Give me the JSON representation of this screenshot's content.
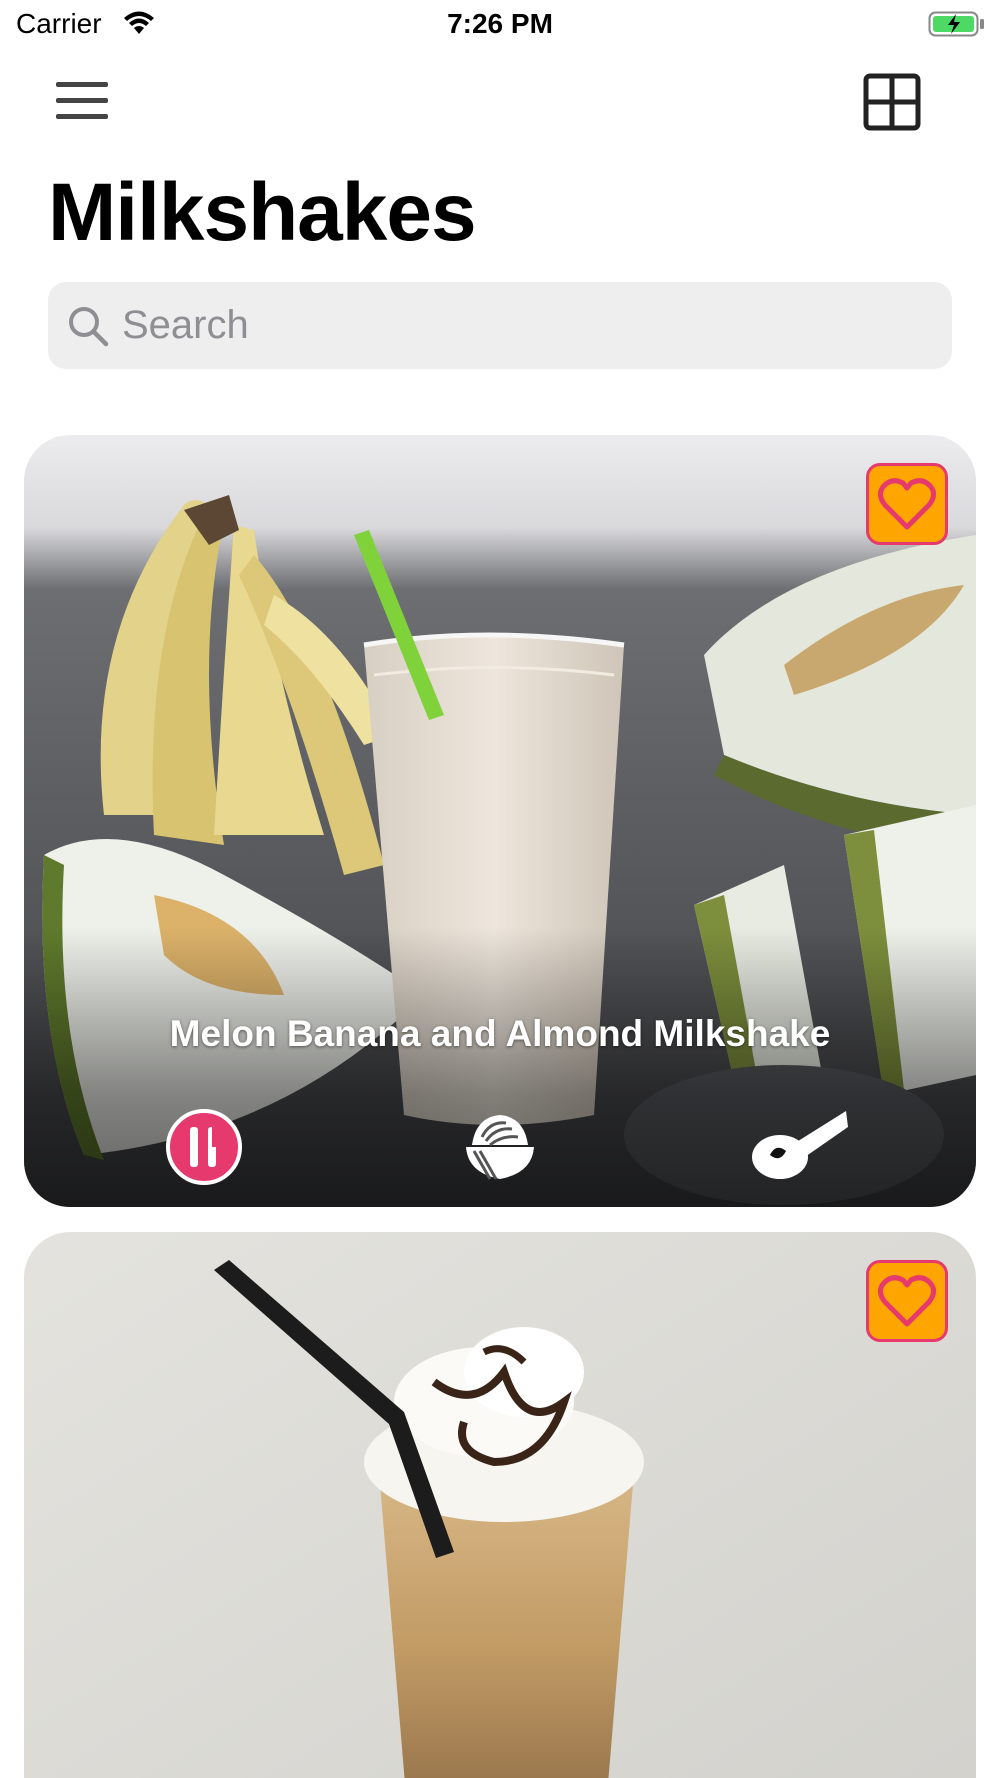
{
  "status_bar": {
    "carrier": "Carrier",
    "time": "7:26 PM"
  },
  "nav": {
    "menu_icon": "hamburger-menu-icon",
    "layout_icon": "grid-layout-icon"
  },
  "page": {
    "title": "Milkshakes"
  },
  "search": {
    "placeholder": "Search"
  },
  "recipes": [
    {
      "title": "Melon Banana and Almond Milkshake",
      "favorite_icon": "heart-icon",
      "info_icons": [
        "utensils-icon",
        "bowl-icon",
        "spoon-icon"
      ]
    },
    {
      "title": "",
      "favorite_icon": "heart-icon"
    }
  ],
  "colors": {
    "favorite_bg": "#ffa500",
    "favorite_border": "#e6396d",
    "utensils_accent": "#e6396d",
    "search_bg": "#eeeeef",
    "battery_green": "#4cd964"
  }
}
